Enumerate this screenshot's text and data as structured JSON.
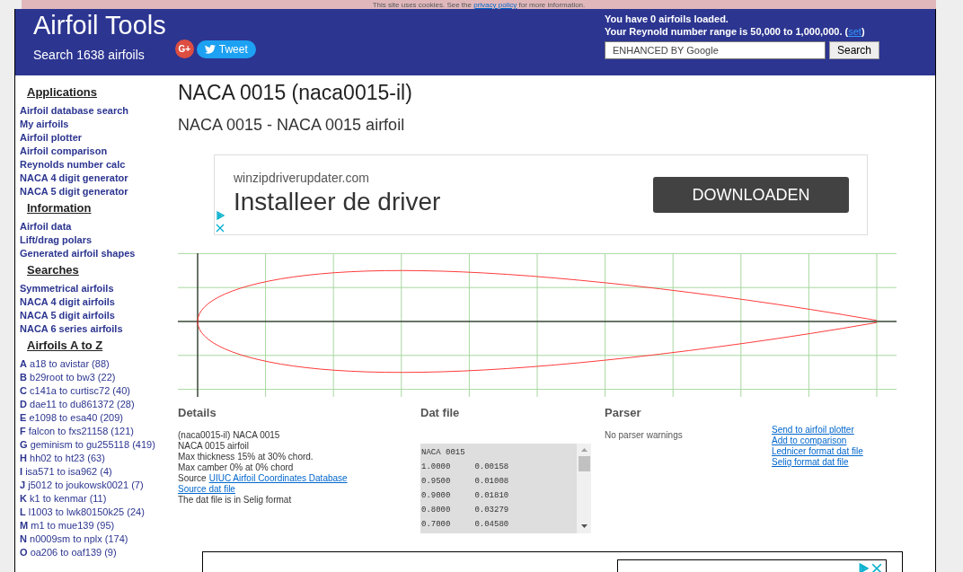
{
  "cookie_bar": {
    "before": "This site uses cookies. See the",
    "link": "privacy policy",
    "after": "for more information."
  },
  "header": {
    "title": "Airfoil Tools",
    "subtitle": "Search 1638 airfoils",
    "tweet_button": "Tweet",
    "google_plus": "G+",
    "loaded_text": "You have 0 airfoils loaded.",
    "reynolds_text": "Your Reynold number range is 50,000 to 1,000,000. (",
    "reynolds_link": "set",
    "reynolds_close": ")",
    "search_placeholder": "ENHANCED BY Google",
    "search_button": "Search"
  },
  "sidebar": [
    {
      "heading": "Applications",
      "items": [
        {
          "text": "Airfoil database search"
        },
        {
          "text": "My airfoils"
        },
        {
          "text": "Airfoil plotter"
        },
        {
          "text": "Airfoil comparison"
        },
        {
          "text": "Reynolds number calc"
        },
        {
          "text": "NACA 4 digit generator"
        },
        {
          "text": "NACA 5 digit generator"
        }
      ]
    },
    {
      "heading": "Information",
      "items": [
        {
          "text": "Airfoil data"
        },
        {
          "text": "Lift/drag polars"
        },
        {
          "text": "Generated airfoil shapes"
        }
      ]
    },
    {
      "heading": "Searches",
      "items": [
        {
          "text": "Symmetrical airfoils"
        },
        {
          "text": "NACA 4 digit airfoils"
        },
        {
          "text": "NACA 5 digit airfoils"
        },
        {
          "text": "NACA 6 series airfoils"
        }
      ]
    },
    {
      "heading": "Airfoils A to Z",
      "items": [
        {
          "letter": "A",
          "text": "a18 to avistar (88)"
        },
        {
          "letter": "B",
          "text": "b29root to bw3 (22)"
        },
        {
          "letter": "C",
          "text": "c141a to curtisc72 (40)"
        },
        {
          "letter": "D",
          "text": "dae11 to du861372 (28)"
        },
        {
          "letter": "E",
          "text": "e1098 to esa40 (209)"
        },
        {
          "letter": "F",
          "text": "falcon to fxs21158 (121)"
        },
        {
          "letter": "G",
          "text": "geminism to gu255118 (419)"
        },
        {
          "letter": "H",
          "text": "hh02 to ht23 (63)"
        },
        {
          "letter": "I",
          "text": "isa571 to isa962 (4)"
        },
        {
          "letter": "J",
          "text": "j5012 to joukowsk0021 (7)"
        },
        {
          "letter": "K",
          "text": "k1 to kenmar (11)"
        },
        {
          "letter": "L",
          "text": "l1003 to lwk80150k25 (24)"
        },
        {
          "letter": "M",
          "text": "m1 to mue139 (95)"
        },
        {
          "letter": "N",
          "text": "n0009sm to nplx (174)"
        },
        {
          "letter": "O",
          "text": "oa206 to oaf139 (9)"
        }
      ]
    }
  ],
  "page": {
    "title": "NACA 0015 (naca0015-il)",
    "subtitle": "NACA 0015 - NACA 0015 airfoil"
  },
  "ad": {
    "domain": "winzipdriverupdater.com",
    "headline": "Installeer de driver",
    "button": "DOWNLOADEN"
  },
  "details": {
    "heading": "Details",
    "lines": [
      {
        "text": "(naca0015-il) NACA 0015"
      },
      {
        "text": "NACA 0015 airfoil"
      },
      {
        "text": "Max thickness 15% at 30% chord."
      },
      {
        "text": "Max camber 0% at 0% chord"
      },
      {
        "text": "Source",
        "link": "UIUC Airfoil Coordinates Database"
      },
      {
        "link": "Source dat file"
      },
      {
        "text": "The dat file is in Selig format"
      }
    ]
  },
  "dat_file": {
    "heading": "Dat file",
    "lines": [
      "NACA 0015",
      "1.0000     0.00158",
      "0.9500     0.01008",
      "0.9000     0.01810",
      "0.8000     0.03279",
      "0.7000     0.04580"
    ]
  },
  "parser": {
    "heading": "Parser",
    "message": "No parser warnings",
    "links": [
      "Send to airfoil plotter",
      "Add to comparison",
      "Lednicer format dat file",
      "Selig format dat file"
    ]
  }
}
